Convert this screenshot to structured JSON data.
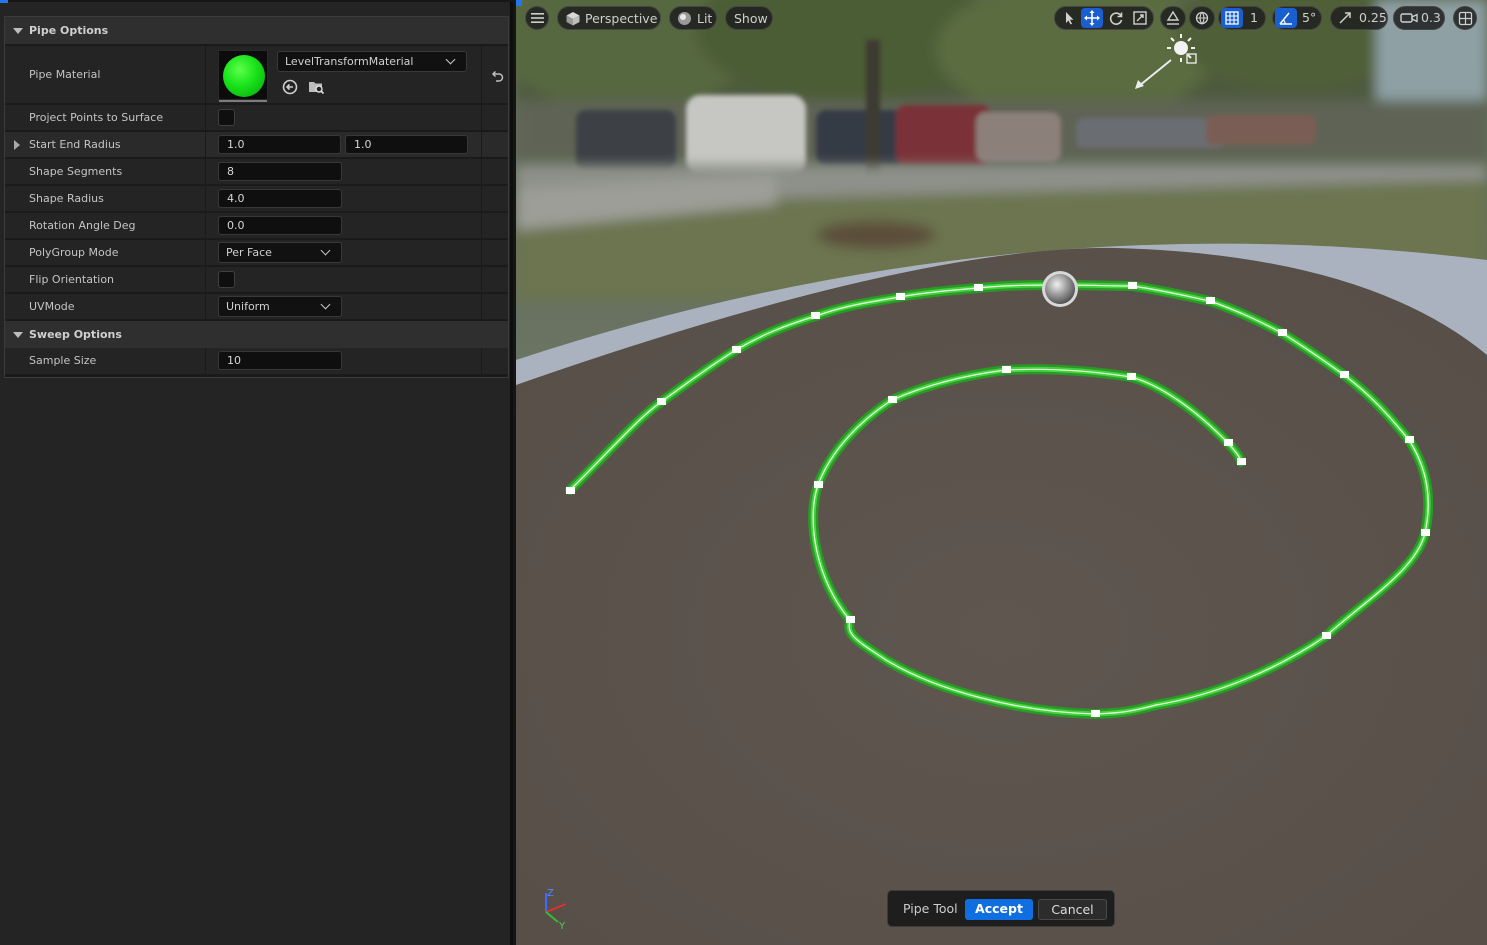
{
  "details": {
    "categories": [
      {
        "label": "Pipe Options"
      },
      {
        "label": "Sweep Options"
      }
    ],
    "pipe_material": {
      "label": "Pipe Material",
      "value": "LevelTransformMaterial",
      "preview_color": "#1ee21e"
    },
    "project_points": {
      "label": "Project Points to Surface",
      "checked": false
    },
    "start_end_radius": {
      "label": "Start End Radius",
      "start": "1.0",
      "end": "1.0"
    },
    "shape_segments": {
      "label": "Shape Segments",
      "value": "8"
    },
    "shape_radius": {
      "label": "Shape Radius",
      "value": "4.0"
    },
    "rotation_angle": {
      "label": "Rotation Angle Deg",
      "value": "0.0"
    },
    "polygroup_mode": {
      "label": "PolyGroup Mode",
      "value": "Per Face"
    },
    "flip_orientation": {
      "label": "Flip Orientation",
      "checked": false
    },
    "uv_mode": {
      "label": "UVMode",
      "value": "Uniform"
    },
    "sample_size": {
      "label": "Sample Size",
      "value": "10"
    }
  },
  "viewport": {
    "toolbar": {
      "menu_icon": "hamburger-icon",
      "perspective_label": "Perspective",
      "lit_label": "Lit",
      "show_label": "Show",
      "grid_snap_value": "1",
      "rotation_snap_value": "5°",
      "scale_snap_value": "0.25",
      "camera_speed_value": "0.3"
    },
    "pipe_color": "#3fd23a",
    "axis_labels": {
      "z": "Z",
      "y": "Y"
    },
    "tool_bar": {
      "tool_label": "Pipe Tool",
      "accept_label": "Accept",
      "cancel_label": "Cancel"
    }
  },
  "colors": {
    "accent_blue": "#1a5fd0",
    "accept_blue": "#0f6fe0",
    "panel_bg": "#242424"
  }
}
